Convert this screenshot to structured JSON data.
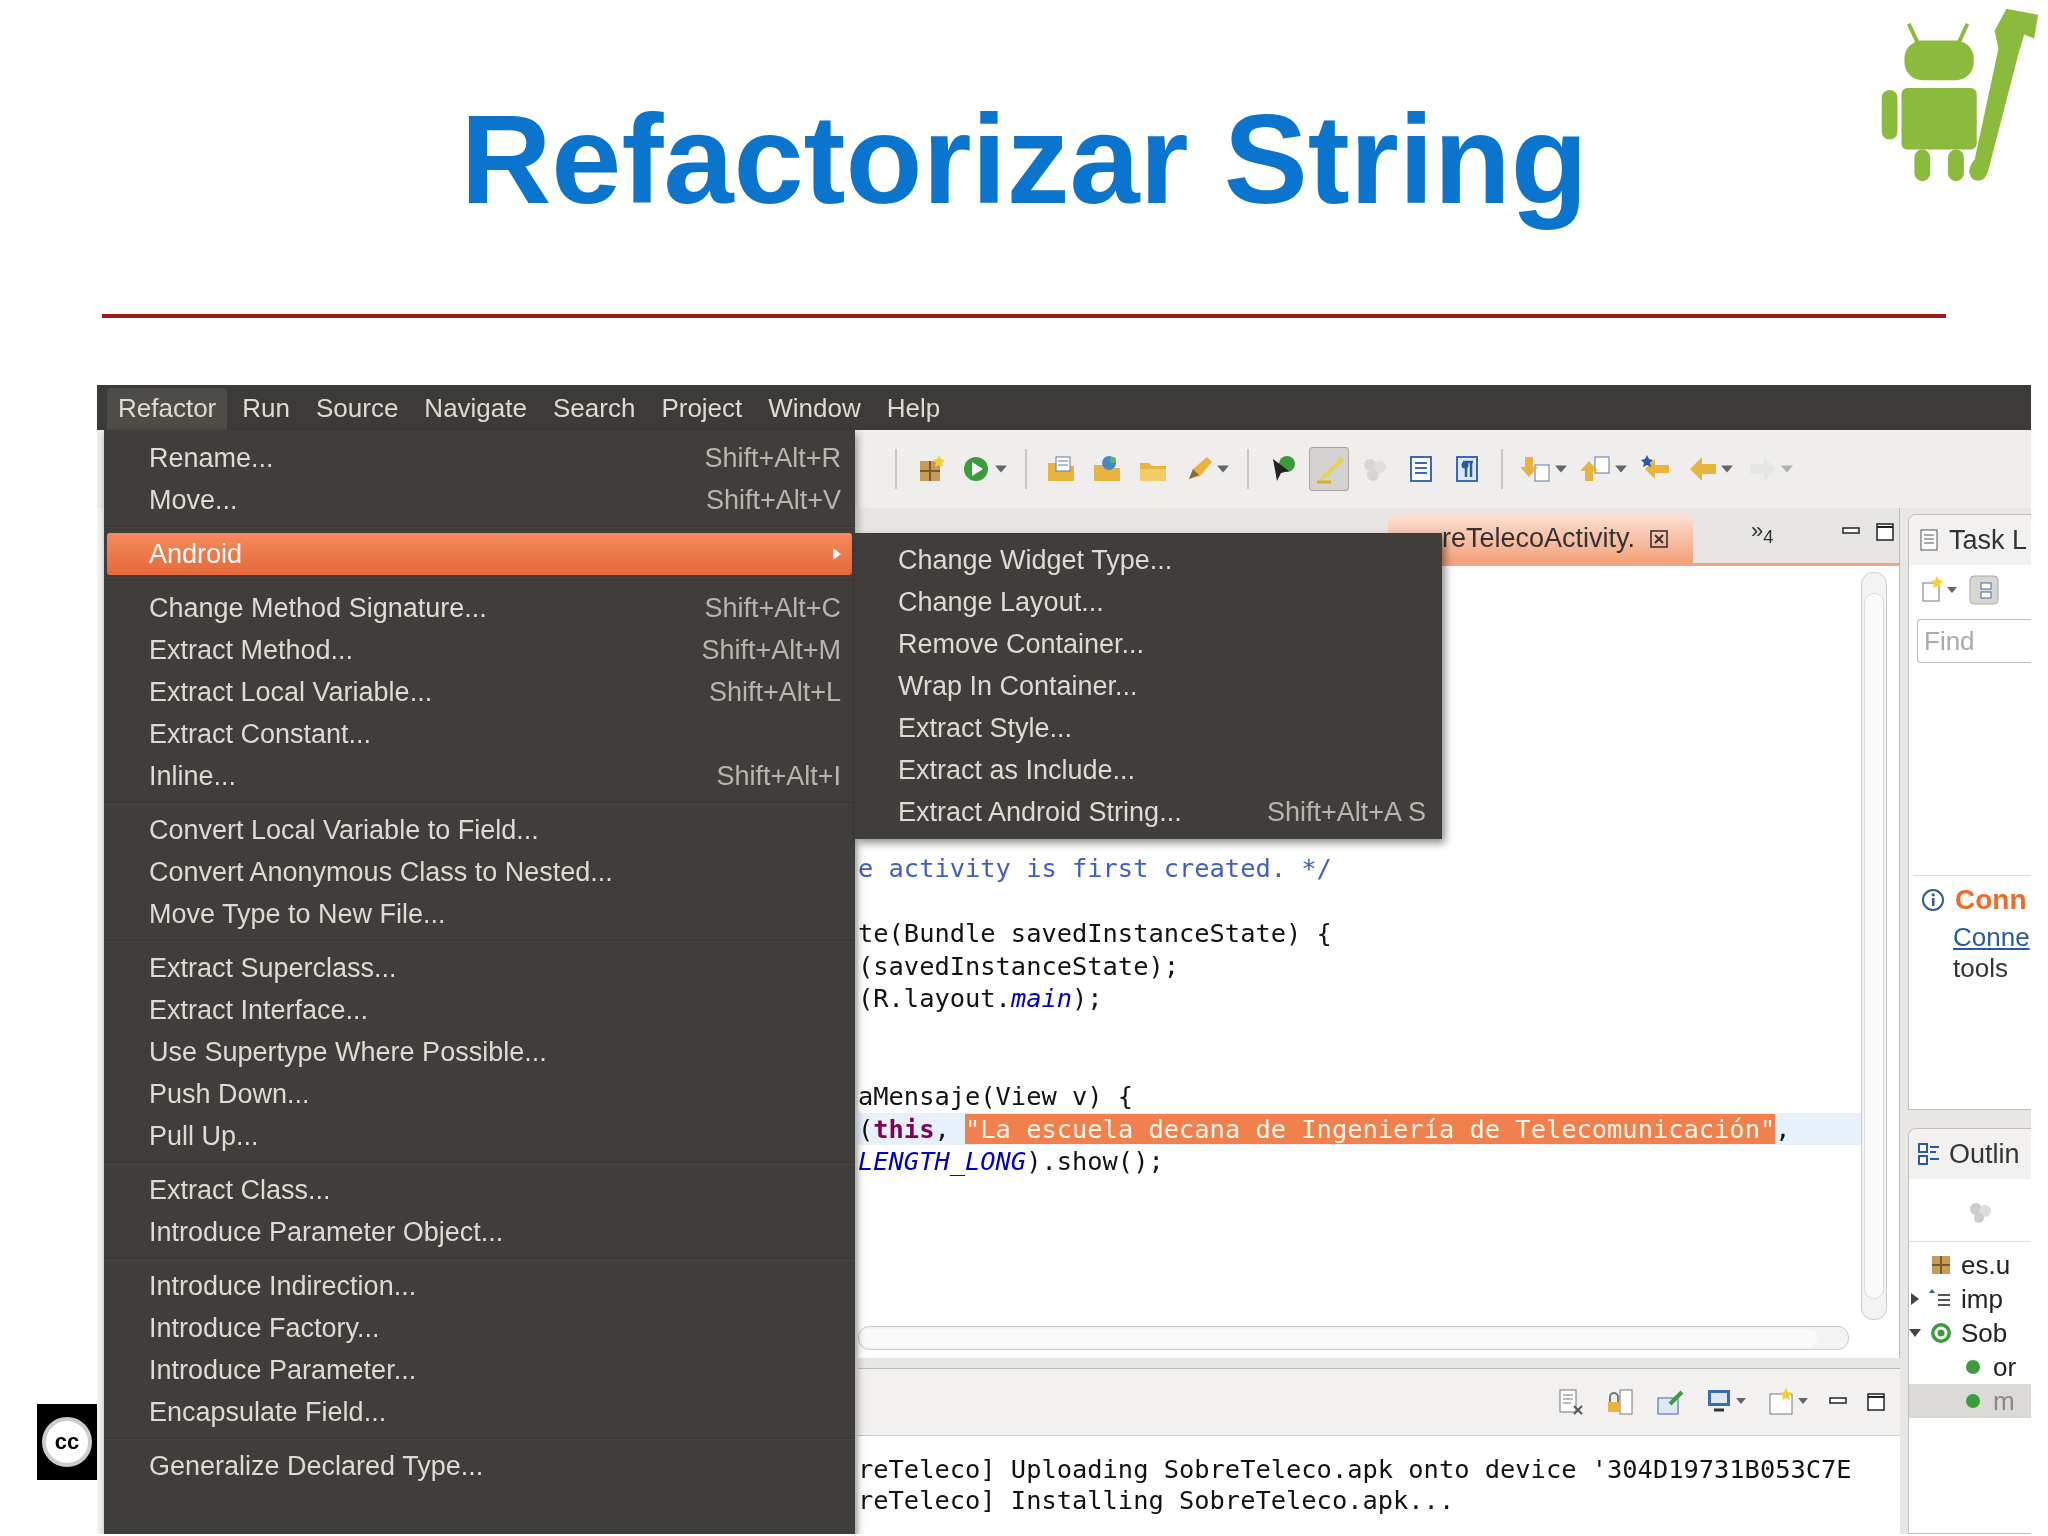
{
  "slide": {
    "title": "Refactorizar String",
    "license_badge": "cc"
  },
  "menu_bar": [
    {
      "label": "Refactor",
      "selected": true
    },
    {
      "label": "Run",
      "selected": false
    },
    {
      "label": "Source",
      "selected": false
    },
    {
      "label": "Navigate",
      "selected": false
    },
    {
      "label": "Search",
      "selected": false
    },
    {
      "label": "Project",
      "selected": false
    },
    {
      "label": "Window",
      "selected": false
    },
    {
      "label": "Help",
      "selected": false
    }
  ],
  "refactor_menu": {
    "sections": [
      {
        "items": [
          {
            "label": "Rename...",
            "shortcut": "Shift+Alt+R",
            "selected": false,
            "has_submenu": false
          },
          {
            "label": "Move...",
            "shortcut": "Shift+Alt+V",
            "selected": false,
            "has_submenu": false
          }
        ]
      },
      {
        "items": [
          {
            "label": "Android",
            "selected": true,
            "has_submenu": true
          }
        ]
      },
      {
        "items": [
          {
            "label": "Change Method Signature...",
            "shortcut": "Shift+Alt+C",
            "selected": false,
            "has_submenu": false
          },
          {
            "label": "Extract Method...",
            "shortcut": "Shift+Alt+M",
            "selected": false,
            "has_submenu": false
          },
          {
            "label": "Extract Local Variable...",
            "shortcut": "Shift+Alt+L",
            "selected": false,
            "has_submenu": false
          },
          {
            "label": "Extract Constant...",
            "selected": false,
            "has_submenu": false
          },
          {
            "label": "Inline...",
            "shortcut": "Shift+Alt+I",
            "selected": false,
            "has_submenu": false
          }
        ]
      },
      {
        "items": [
          {
            "label": "Convert Local Variable to Field...",
            "selected": false,
            "has_submenu": false
          },
          {
            "label": "Convert Anonymous Class to Nested...",
            "selected": false,
            "has_submenu": false
          },
          {
            "label": "Move Type to New File...",
            "selected": false,
            "has_submenu": false
          }
        ]
      },
      {
        "items": [
          {
            "label": "Extract Superclass...",
            "selected": false,
            "has_submenu": false
          },
          {
            "label": "Extract Interface...",
            "selected": false,
            "has_submenu": false
          },
          {
            "label": "Use Supertype Where Possible...",
            "selected": false,
            "has_submenu": false
          },
          {
            "label": "Push Down...",
            "selected": false,
            "has_submenu": false
          },
          {
            "label": "Pull Up...",
            "selected": false,
            "has_submenu": false
          }
        ]
      },
      {
        "items": [
          {
            "label": "Extract Class...",
            "selected": false,
            "has_submenu": false
          },
          {
            "label": "Introduce Parameter Object...",
            "selected": false,
            "has_submenu": false
          }
        ]
      },
      {
        "items": [
          {
            "label": "Introduce Indirection...",
            "selected": false,
            "has_submenu": false
          },
          {
            "label": "Introduce Factory...",
            "selected": false,
            "has_submenu": false
          },
          {
            "label": "Introduce Parameter...",
            "selected": false,
            "has_submenu": false
          },
          {
            "label": "Encapsulate Field...",
            "selected": false,
            "has_submenu": false
          }
        ]
      },
      {
        "items": [
          {
            "label": "Generalize Declared Type...",
            "selected": false,
            "has_submenu": false
          }
        ]
      }
    ]
  },
  "android_submenu": {
    "items": [
      {
        "label": "Change Widget Type..."
      },
      {
        "label": "Change Layout..."
      },
      {
        "label": "Remove Container..."
      },
      {
        "label": "Wrap In Container..."
      },
      {
        "label": "Extract Style..."
      },
      {
        "label": "Extract as Include..."
      },
      {
        "label": "Extract Android String...",
        "shortcut": "Shift+Alt+A S"
      }
    ]
  },
  "toolbar": [
    {
      "buttons": [
        {
          "kind": "package",
          "selected": false,
          "disabled": false,
          "dropdown": false
        },
        {
          "kind": "run",
          "selected": false,
          "disabled": false,
          "dropdown": true
        }
      ]
    },
    {
      "buttons": [
        {
          "kind": "folder-document",
          "selected": false,
          "disabled": false,
          "dropdown": false
        },
        {
          "kind": "folder-globe",
          "selected": false,
          "disabled": false,
          "dropdown": false
        },
        {
          "kind": "folder",
          "selected": false,
          "disabled": false,
          "dropdown": false
        },
        {
          "kind": "pencil",
          "selected": false,
          "disabled": false,
          "dropdown": true
        }
      ]
    },
    {
      "buttons": [
        {
          "kind": "cursor",
          "selected": false,
          "disabled": false,
          "dropdown": false
        },
        {
          "kind": "highlighter",
          "selected": true,
          "disabled": false,
          "dropdown": false
        },
        {
          "kind": "dots",
          "selected": false,
          "disabled": true,
          "dropdown": false
        },
        {
          "kind": "document",
          "selected": false,
          "disabled": false,
          "dropdown": false
        },
        {
          "kind": "paragraph",
          "selected": false,
          "disabled": false,
          "dropdown": false
        }
      ]
    },
    {
      "buttons": [
        {
          "kind": "arrow-down",
          "selected": false,
          "disabled": false,
          "dropdown": true
        },
        {
          "kind": "arrow-up",
          "selected": false,
          "disabled": false,
          "dropdown": true
        },
        {
          "kind": "back-star",
          "selected": false,
          "disabled": false,
          "dropdown": false
        },
        {
          "kind": "arrow-left",
          "selected": false,
          "disabled": false,
          "dropdown": true
        },
        {
          "kind": "arrow-right",
          "selected": false,
          "disabled": true,
          "dropdown": true
        }
      ]
    }
  ],
  "editor": {
    "tab": {
      "label": "reTelecoActivity.",
      "selected": true
    },
    "overflow": "»$_{4}$",
    "lines": [
      {
        "kind": "code",
        "current": false,
        "segments": [
          {
            "kind": "comment",
            "text": "e activity is first created. */"
          }
        ]
      },
      {
        "kind": "blank"
      },
      {
        "kind": "code",
        "current": false,
        "segments": [
          {
            "kind": "plain",
            "text": "te(Bundle savedInstanceState) {"
          }
        ]
      },
      {
        "kind": "code",
        "current": false,
        "segments": [
          {
            "kind": "plain",
            "text": "(savedInstanceState);"
          }
        ]
      },
      {
        "kind": "code",
        "current": false,
        "segments": [
          {
            "kind": "plain",
            "text": "(R.layout."
          },
          {
            "kind": "field",
            "text": "main"
          },
          {
            "kind": "plain",
            "text": ");"
          }
        ]
      },
      {
        "kind": "blank"
      },
      {
        "kind": "blank"
      },
      {
        "kind": "code",
        "current": false,
        "segments": [
          {
            "kind": "plain",
            "text": "aMensaje(View v) {"
          }
        ]
      },
      {
        "kind": "code",
        "current": true,
        "segments": [
          {
            "kind": "plain",
            "text": "("
          },
          {
            "kind": "keyword",
            "text": "this"
          },
          {
            "kind": "plain",
            "text": ", "
          },
          {
            "kind": "selection",
            "text": "\"La escuela decana de Ingeniería de Telecomunicación\""
          },
          {
            "kind": "plain",
            "text": ","
          }
        ]
      },
      {
        "kind": "code",
        "current": false,
        "segments": [
          {
            "kind": "field",
            "text": "LENGTH_LONG"
          },
          {
            "kind": "plain",
            "text": ").show();"
          }
        ]
      }
    ]
  },
  "console": {
    "lines": [
      "reTeleco] Uploading SobreTeleco.apk onto device '304D19731B053C7E",
      "reTeleco] Installing SobreTeleco.apk..."
    ]
  },
  "task_list": {
    "title": "Task L",
    "find": {
      "placeholder": "Find"
    },
    "connect": {
      "heading": "Conn",
      "link": "Conne",
      "text": "tools"
    }
  },
  "outline": {
    "title": "Outlin",
    "tree": [
      {
        "label": "es.u",
        "kind": "package"
      },
      {
        "label": "imp",
        "kind": "imports",
        "expanded": false
      },
      {
        "label": "Sob",
        "kind": "class",
        "expanded": true,
        "children": [
          {
            "label": "or",
            "kind": "method",
            "selected": false
          },
          {
            "label": "m",
            "kind": "method",
            "selected": true
          }
        ]
      }
    ]
  }
}
